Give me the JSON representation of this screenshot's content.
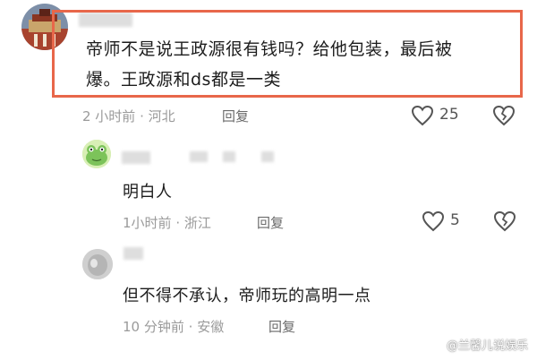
{
  "comments": [
    {
      "text_line1": "帝师不是说王政源很有钱吗？给他包装，最后被",
      "text_line2": "爆。王政源和ds都是一类",
      "time": "2 小时前",
      "location": "河北",
      "reply_label": "回复",
      "likes": "25"
    },
    {
      "text": "明白人",
      "time": "1小时前",
      "location": "浙江",
      "reply_label": "回复",
      "likes": "5"
    },
    {
      "text": "但不得不承认，帝师玩的高明一点",
      "time": "10 分钟前",
      "location": "安徽",
      "reply_label": "回复"
    }
  ],
  "separator": "·",
  "watermark": "@兰馨儿说娱乐",
  "colors": {
    "highlight_border": "#e8674a",
    "meta_text": "#9a9a9a"
  }
}
